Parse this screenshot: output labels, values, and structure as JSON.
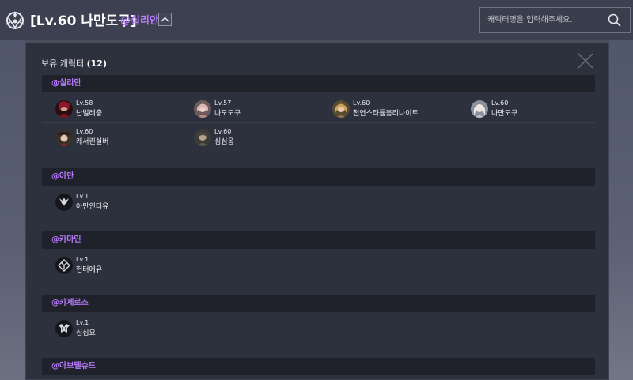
{
  "header": {
    "title": "[Lv.60 나만도구]",
    "server": "@실리안",
    "toggle_icon": "chevron-up-icon"
  },
  "search": {
    "placeholder": "캐릭터명을 입력해주세요.",
    "icon": "search-icon"
  },
  "modal": {
    "title": "보유 캐릭터",
    "count": "(12)",
    "close_icon": "close-icon"
  },
  "colors": {
    "accent": "#b97cff",
    "header_bg": "#3d4050",
    "modal_bg": "#2d313e",
    "group_header_bg": "#1f222b"
  },
  "groups": [
    {
      "server": "@실리안",
      "characters": [
        {
          "level": "Lv.58",
          "name": "난벌레충",
          "avatar": "portrait-avatar"
        },
        {
          "level": "Lv.57",
          "name": "나도도구",
          "avatar": "portrait-avatar"
        },
        {
          "level": "Lv.60",
          "name": "천연스타듐홀리나이트",
          "avatar": "portrait-avatar"
        },
        {
          "level": "Lv.60",
          "name": "나만도구",
          "avatar": "portrait-avatar"
        },
        {
          "level": "Lv.60",
          "name": "캐서린실버",
          "avatar": "portrait-avatar"
        },
        {
          "level": "Lv.60",
          "name": "심심옹",
          "avatar": "portrait-avatar"
        }
      ]
    },
    {
      "server": "@아만",
      "characters": [
        {
          "level": "Lv.1",
          "name": "아만인더유",
          "avatar": "class-emblem-icon"
        }
      ]
    },
    {
      "server": "@카마인",
      "characters": [
        {
          "level": "Lv.1",
          "name": "헌터에유",
          "avatar": "class-emblem-icon"
        }
      ]
    },
    {
      "server": "@카제로스",
      "characters": [
        {
          "level": "Lv.1",
          "name": "심심요",
          "avatar": "class-emblem-icon"
        }
      ]
    },
    {
      "server": "@아브렐슈드",
      "characters": []
    }
  ]
}
